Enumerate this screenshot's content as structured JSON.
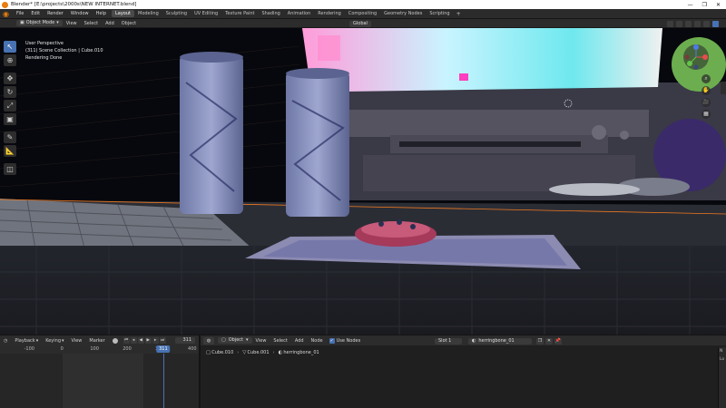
{
  "window": {
    "title": "Blender* [E:\\projects\\2000s\\NEW INTERNET.blend]",
    "controls": [
      "—",
      "❐",
      "✕"
    ]
  },
  "menubar": {
    "items": [
      "File",
      "Edit",
      "Render",
      "Window",
      "Help"
    ],
    "tabs": [
      "Layout",
      "Modeling",
      "Sculpting",
      "UV Editing",
      "Texture Paint",
      "Shading",
      "Animation",
      "Rendering",
      "Compositing",
      "Geometry Nodes",
      "Scripting"
    ],
    "active_tab": "Layout",
    "add_tab": "+"
  },
  "viewport_header": {
    "mode": "Object Mode",
    "menus": [
      "View",
      "Select",
      "Add",
      "Object"
    ],
    "orientation": "Global"
  },
  "viewport": {
    "overlay_lines": [
      "User Perspective",
      "(311) Scene Collection | Cube.010",
      "Rendering Done"
    ],
    "tools": [
      "select-box",
      "cursor",
      "move",
      "rotate",
      "scale",
      "transform",
      "annotate",
      "measure",
      "add-cube"
    ]
  },
  "timeline": {
    "menus": [
      "Playback",
      "Keying",
      "View",
      "Marker"
    ],
    "current_frame": "311",
    "ruler_ticks": [
      "-100",
      "0",
      "100",
      "200",
      "300",
      "400"
    ],
    "ruler_tick_frames": [
      -100,
      0,
      100,
      200,
      300,
      400
    ],
    "playhead_frame": 311,
    "range_start": 1,
    "range_end": 250,
    "view_range": [
      -190,
      420
    ]
  },
  "node_editor": {
    "object_select": "Object",
    "menus": [
      "View",
      "Select",
      "Add",
      "Node"
    ],
    "use_nodes_label": "Use Nodes",
    "use_nodes": true,
    "slot": "Slot 1",
    "material": "herringbone_01",
    "breadcrumb": [
      "Cube.010",
      "Cube.001",
      "herringbone_01"
    ],
    "side_tabs": [
      "N",
      "Lo"
    ]
  },
  "colors": {
    "accent": "#4772b3",
    "blender_orange": "#e87d0d"
  }
}
